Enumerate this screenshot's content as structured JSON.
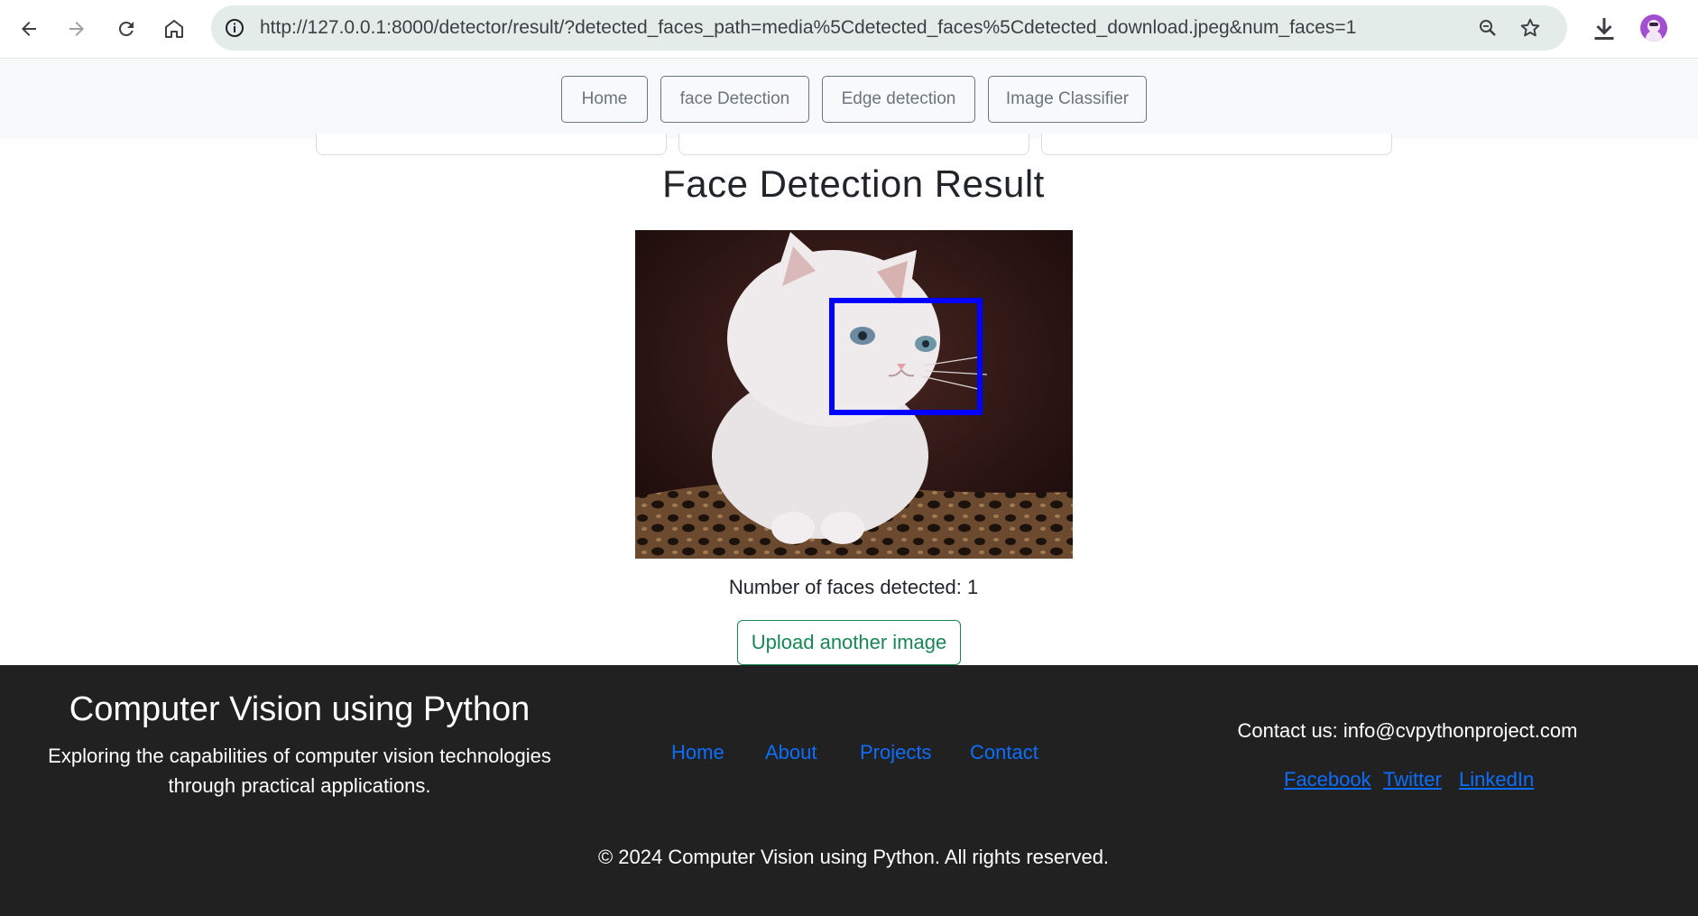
{
  "browser": {
    "url": "http://127.0.0.1:8000/detector/result/?detected_faces_path=media%5Cdetected_faces%5Cdetected_download.jpeg&num_faces=1"
  },
  "topnav": {
    "items": [
      {
        "label": "Home"
      },
      {
        "label": "face Detection"
      },
      {
        "label": "Edge detection"
      },
      {
        "label": "Image Classifier"
      }
    ]
  },
  "main": {
    "title": "Face Detection Result",
    "faces_count_text": "Number of faces detected: 1",
    "upload_label": "Upload another image"
  },
  "footer": {
    "title": "Computer Vision using Python",
    "description": "Exploring the capabilities of computer vision technologies through practical applications.",
    "links": [
      {
        "label": "Home"
      },
      {
        "label": "About"
      },
      {
        "label": "Projects"
      },
      {
        "label": "Contact"
      }
    ],
    "contact": "Contact us: info@cvpythonproject.com",
    "social": [
      {
        "label": "Facebook"
      },
      {
        "label": "Twitter"
      },
      {
        "label": "LinkedIn"
      }
    ],
    "copyright": "© 2024 Computer Vision using Python. All rights reserved."
  },
  "colors": {
    "footer_bg": "#212121",
    "link": "#0d6efd",
    "upload_accent": "#198754",
    "detection_box": "#0000ff"
  },
  "icons": [
    "back-arrow-icon",
    "forward-arrow-icon",
    "reload-icon",
    "home-icon",
    "info-icon",
    "zoom-icon",
    "star-icon",
    "download-icon",
    "profile-avatar"
  ]
}
